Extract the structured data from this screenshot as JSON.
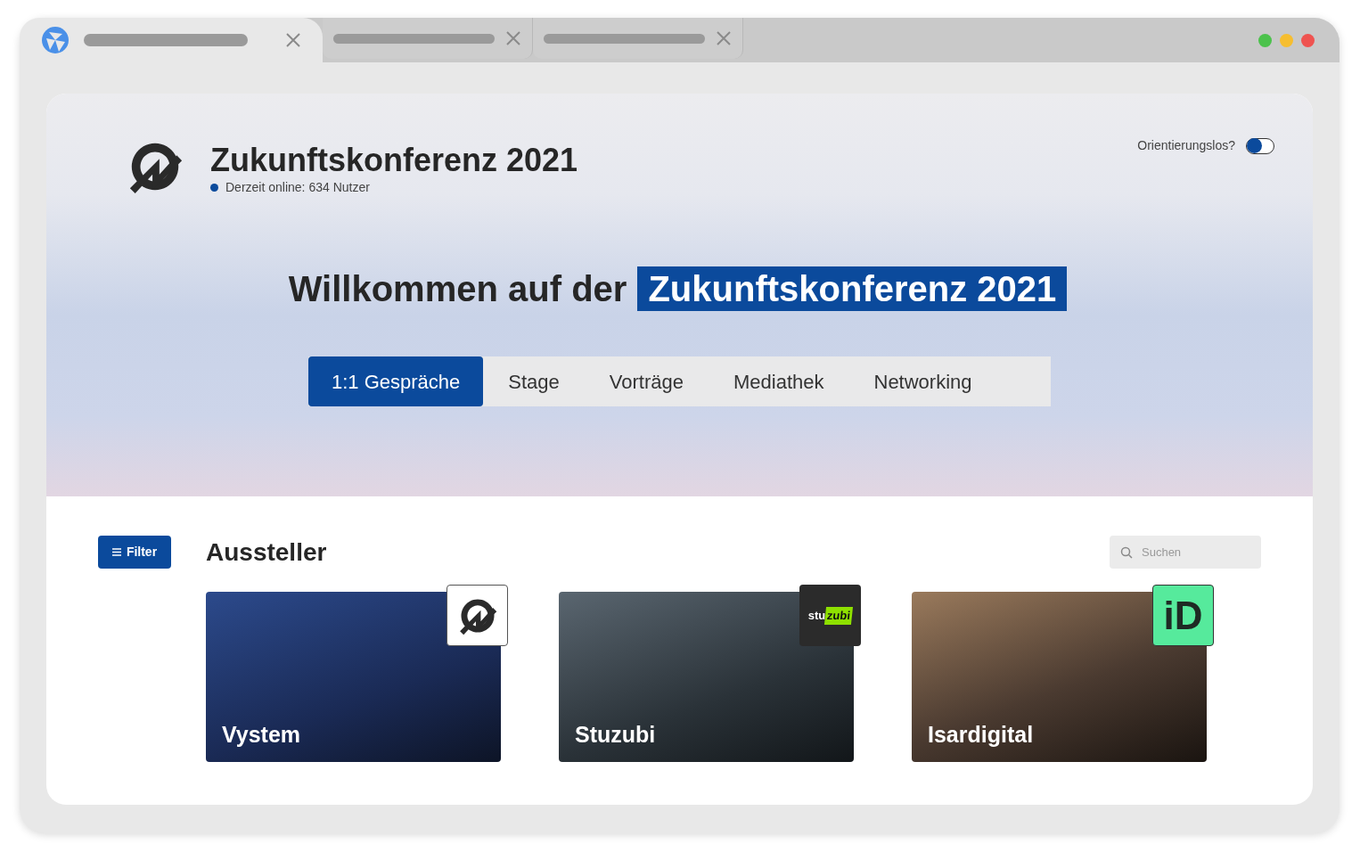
{
  "browser": {
    "tabs": [
      {
        "selected": true
      },
      {
        "selected": false
      },
      {
        "selected": false
      }
    ]
  },
  "header": {
    "title": "Zukunftskonferenz 2021",
    "online_text": "Derzeit online: 634 Nutzer",
    "toggle": {
      "label": "Orientierungslos?",
      "on": false
    }
  },
  "hero": {
    "heading_plain": "Willkommen auf der",
    "heading_highlight": "Zukunftskonferenz 2021"
  },
  "nav_tabs": [
    {
      "label": "1:1 Gespräche",
      "selected": true
    },
    {
      "label": "Stage",
      "selected": false
    },
    {
      "label": "Vorträge",
      "selected": false
    },
    {
      "label": "Mediathek",
      "selected": false
    },
    {
      "label": "Networking",
      "selected": false
    }
  ],
  "exhibitors": {
    "filter_button": "Filter",
    "title": "Aussteller",
    "search": {
      "placeholder": "Suchen"
    },
    "cards": [
      {
        "name": "Vystem",
        "logo": {
          "kind": "mark"
        }
      },
      {
        "name": "Stuzubi",
        "logo": {
          "kind": "wordmark",
          "text": [
            "stu",
            "zubi"
          ]
        }
      },
      {
        "name": "Isardigital",
        "logo": {
          "kind": "letters",
          "text": [
            "iD"
          ]
        }
      }
    ]
  }
}
